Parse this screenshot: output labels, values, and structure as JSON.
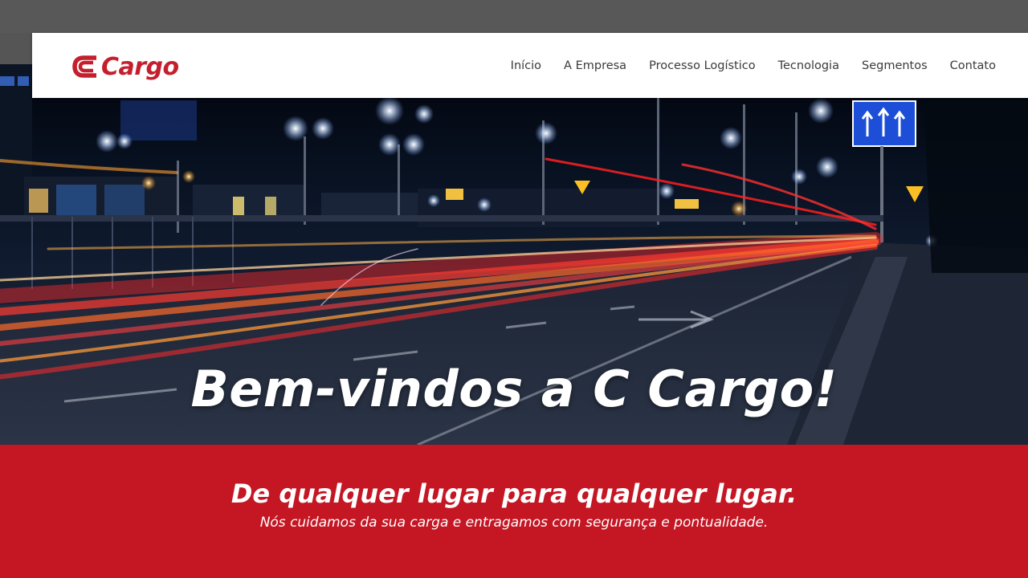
{
  "brand": {
    "name": "Cargo",
    "accent_color": "#c41f2d",
    "logo_icon": "c-logo-icon"
  },
  "nav": {
    "items": [
      {
        "label": "Início"
      },
      {
        "label": "A Empresa"
      },
      {
        "label": "Processo Logístico"
      },
      {
        "label": "Tecnologia"
      },
      {
        "label": "Segmentos"
      },
      {
        "label": "Contato"
      }
    ]
  },
  "hero": {
    "title": "Bem-vindos a C Cargo!"
  },
  "band": {
    "title": "De qualquer lugar para qualquer lugar.",
    "subtitle": "Nós cuidamos da sua carga e entragamos com segurança e pontualidade.",
    "background_color": "#c41623"
  }
}
